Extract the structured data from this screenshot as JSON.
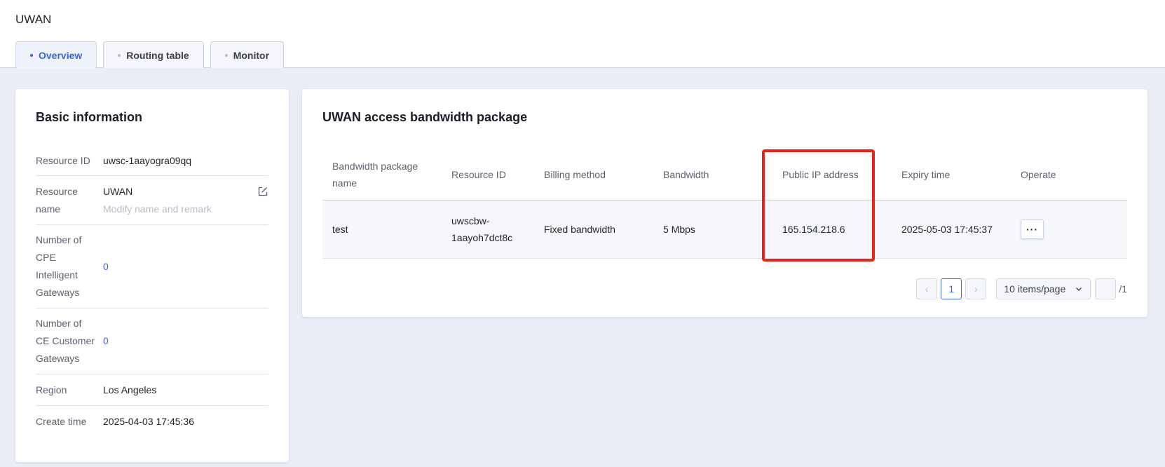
{
  "app": {
    "title": "UWAN"
  },
  "tabs": [
    {
      "label": "Overview",
      "active": true
    },
    {
      "label": "Routing table",
      "active": false
    },
    {
      "label": "Monitor",
      "active": false
    }
  ],
  "basic_info": {
    "title": "Basic information",
    "resource_id_label": "Resource ID",
    "resource_id_value": "uwsc-1aayogra09qq",
    "resource_name_label_1": "Resource",
    "resource_name_label_2": "name",
    "resource_name_value": "UWAN",
    "resource_name_hint": "Modify name and remark",
    "cpe_label_1": "Number of",
    "cpe_label_2": "CPE",
    "cpe_label_3": "Intelligent",
    "cpe_label_4": "Gateways",
    "cpe_value": "0",
    "ce_label_1": "Number of",
    "ce_label_2": "CE Customer",
    "ce_label_3": "Gateways",
    "ce_value": "0",
    "region_label": "Region",
    "region_value": "Los Angeles",
    "create_time_label": "Create time",
    "create_time_value": "2025-04-03 17:45:36"
  },
  "bandwidth": {
    "title": "UWAN access bandwidth package",
    "columns": {
      "name_1": "Bandwidth package",
      "name_2": "name",
      "resource_id": "Resource ID",
      "billing": "Billing method",
      "bandwidth": "Bandwidth",
      "public_ip": "Public IP address",
      "expiry": "Expiry time",
      "operate": "Operate"
    },
    "rows": [
      {
        "name": "test",
        "resource_id_1": "uwscbw-",
        "resource_id_2": "1aayoh7dct8c",
        "billing": "Fixed bandwidth",
        "bandwidth": "5 Mbps",
        "public_ip": "165.154.218.6",
        "expiry": "2025-05-03 17:45:37",
        "operate": "···"
      }
    ],
    "pager": {
      "prev": "‹",
      "current": "1",
      "next": "›",
      "page_size": "10 items/page",
      "total_pages": "/1"
    }
  },
  "colors": {
    "accent": "#3b64e0",
    "highlight": "#e8221c"
  }
}
